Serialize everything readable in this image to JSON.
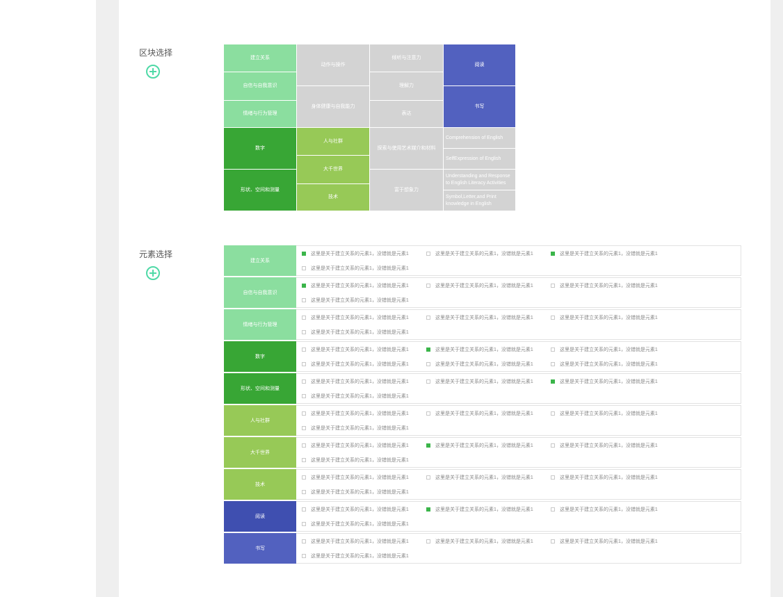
{
  "labels": {
    "block_select": "区块选择",
    "element_select": "元素选择"
  },
  "colors": {
    "light_green": "#8bde9f",
    "dark_green": "#38a635",
    "yellow_green": "#97c957",
    "gray": "#d3d3d3",
    "blue": "#5261bf",
    "dark_blue": "#3f4fb0",
    "check_on": "#3bb54a",
    "add_icon": "#4ed9a6"
  },
  "grid": {
    "col1": [
      "建立关系",
      "自信与自我意识",
      "情绪与行为管理",
      "数字",
      "形状、空间和测量"
    ],
    "col2": [
      "动作与操作",
      "身体健康与自我能力",
      "人与社群",
      "大千世界",
      "技术"
    ],
    "col3": [
      "倾听与注意力",
      "理解力",
      "表达",
      "探索与使用艺术媒介和材料",
      "富于想象力"
    ],
    "col4": [
      "阅读",
      "书写",
      "Comprehension of English",
      "SelfExpression of English",
      "Understanding and Response to English Literacy Activities",
      "Symbol,Letter,and Print knowledge in English"
    ]
  },
  "element_text": "这里是关于建立关系的元素1，没错就是元素1",
  "element_rows": [
    {
      "title": "建立关系",
      "checks": [
        true,
        false,
        true,
        false
      ]
    },
    {
      "title": "自信与自我意识",
      "checks": [
        true,
        false,
        false,
        false
      ]
    },
    {
      "title": "情绪与行为管理",
      "checks": [
        false,
        false,
        false,
        false
      ]
    },
    {
      "title": "数字",
      "checks": [
        false,
        true,
        false,
        false,
        false,
        false
      ]
    },
    {
      "title": "形状、空间和测量",
      "checks": [
        false,
        false,
        true,
        false
      ]
    },
    {
      "title": "人与社群",
      "checks": [
        false,
        false,
        false,
        false
      ]
    },
    {
      "title": "大千世界",
      "checks": [
        false,
        true,
        false,
        false
      ]
    },
    {
      "title": "技术",
      "checks": [
        false,
        false,
        false,
        false
      ]
    },
    {
      "title": "阅读",
      "checks": [
        false,
        true,
        false,
        false
      ]
    },
    {
      "title": "书写",
      "checks": [
        false,
        false,
        false,
        false
      ]
    }
  ]
}
